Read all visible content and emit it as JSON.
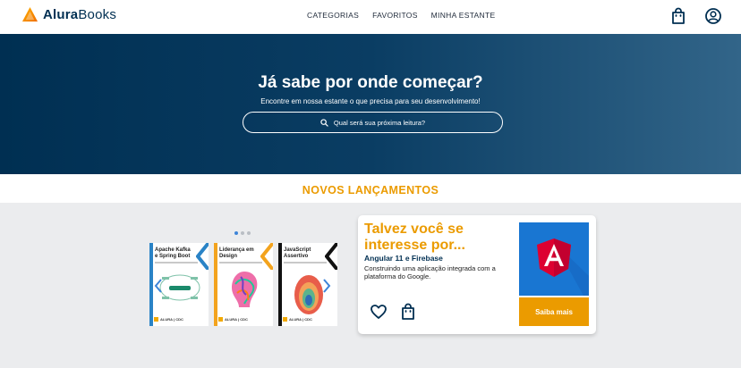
{
  "header": {
    "logo_bold": "Alura",
    "logo_rest": "Books",
    "nav": [
      "CATEGORIAS",
      "FAVORITOS",
      "MINHA ESTANTE"
    ],
    "icons": [
      "shopping-bag-icon",
      "user-icon"
    ]
  },
  "hero": {
    "title": "Já sabe por onde começar?",
    "subtitle": "Encontre em nossa estante o que precisa para seu desenvolvimento!",
    "search_placeholder": "Qual será sua próxima leitura?"
  },
  "section": {
    "title": "NOVOS LANÇAMENTOS"
  },
  "carousel": {
    "dots": 3,
    "active_dot": 0,
    "books": [
      {
        "title": "Apache Kafka e Spring Boot",
        "accent": "#2a83c6",
        "publisher": "ALURA | CDC"
      },
      {
        "title": "Liderança em Design",
        "accent": "#f3a31d",
        "publisher": "ALURA | CDC"
      },
      {
        "title": "JavaScript Assertivo",
        "accent": "#111111",
        "publisher": "ALURA | CDC"
      }
    ]
  },
  "featured": {
    "heading": "Talvez você se interesse por...",
    "book_title": "Angular 11 e Firebase",
    "description": "Construindo uma aplicação integrada com a plataforma do Google.",
    "button_label": "Saiba mais",
    "accent_color": "#eb9b00",
    "cover_color": "#1976d2"
  }
}
